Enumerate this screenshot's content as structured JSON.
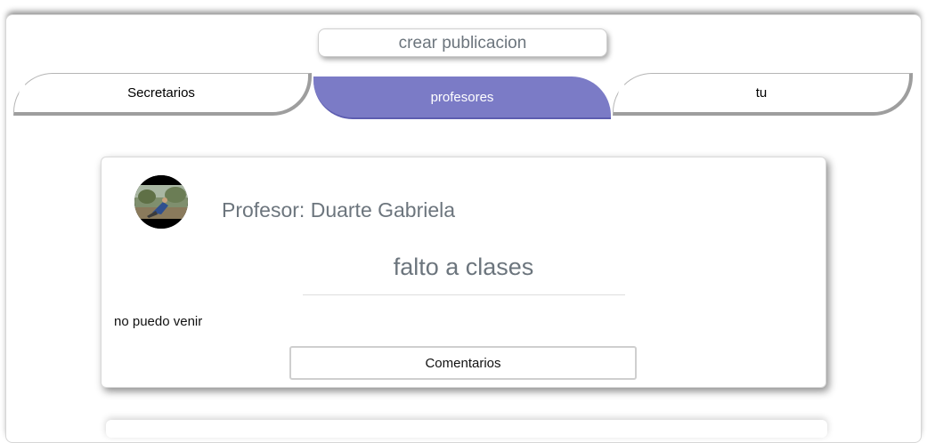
{
  "header": {
    "create_post_label": "crear publicacion"
  },
  "tabs": [
    {
      "label": "Secretarios",
      "active": false
    },
    {
      "label": "profesores",
      "active": true
    },
    {
      "label": "tu",
      "active": false
    }
  ],
  "colors": {
    "active_tab": "#7b7bc6",
    "muted_text": "#6c757d"
  },
  "post": {
    "author": "Profesor: Duarte Gabriela",
    "title": "falto a clases",
    "body": "no puedo venir",
    "comments_label": "Comentarios"
  }
}
